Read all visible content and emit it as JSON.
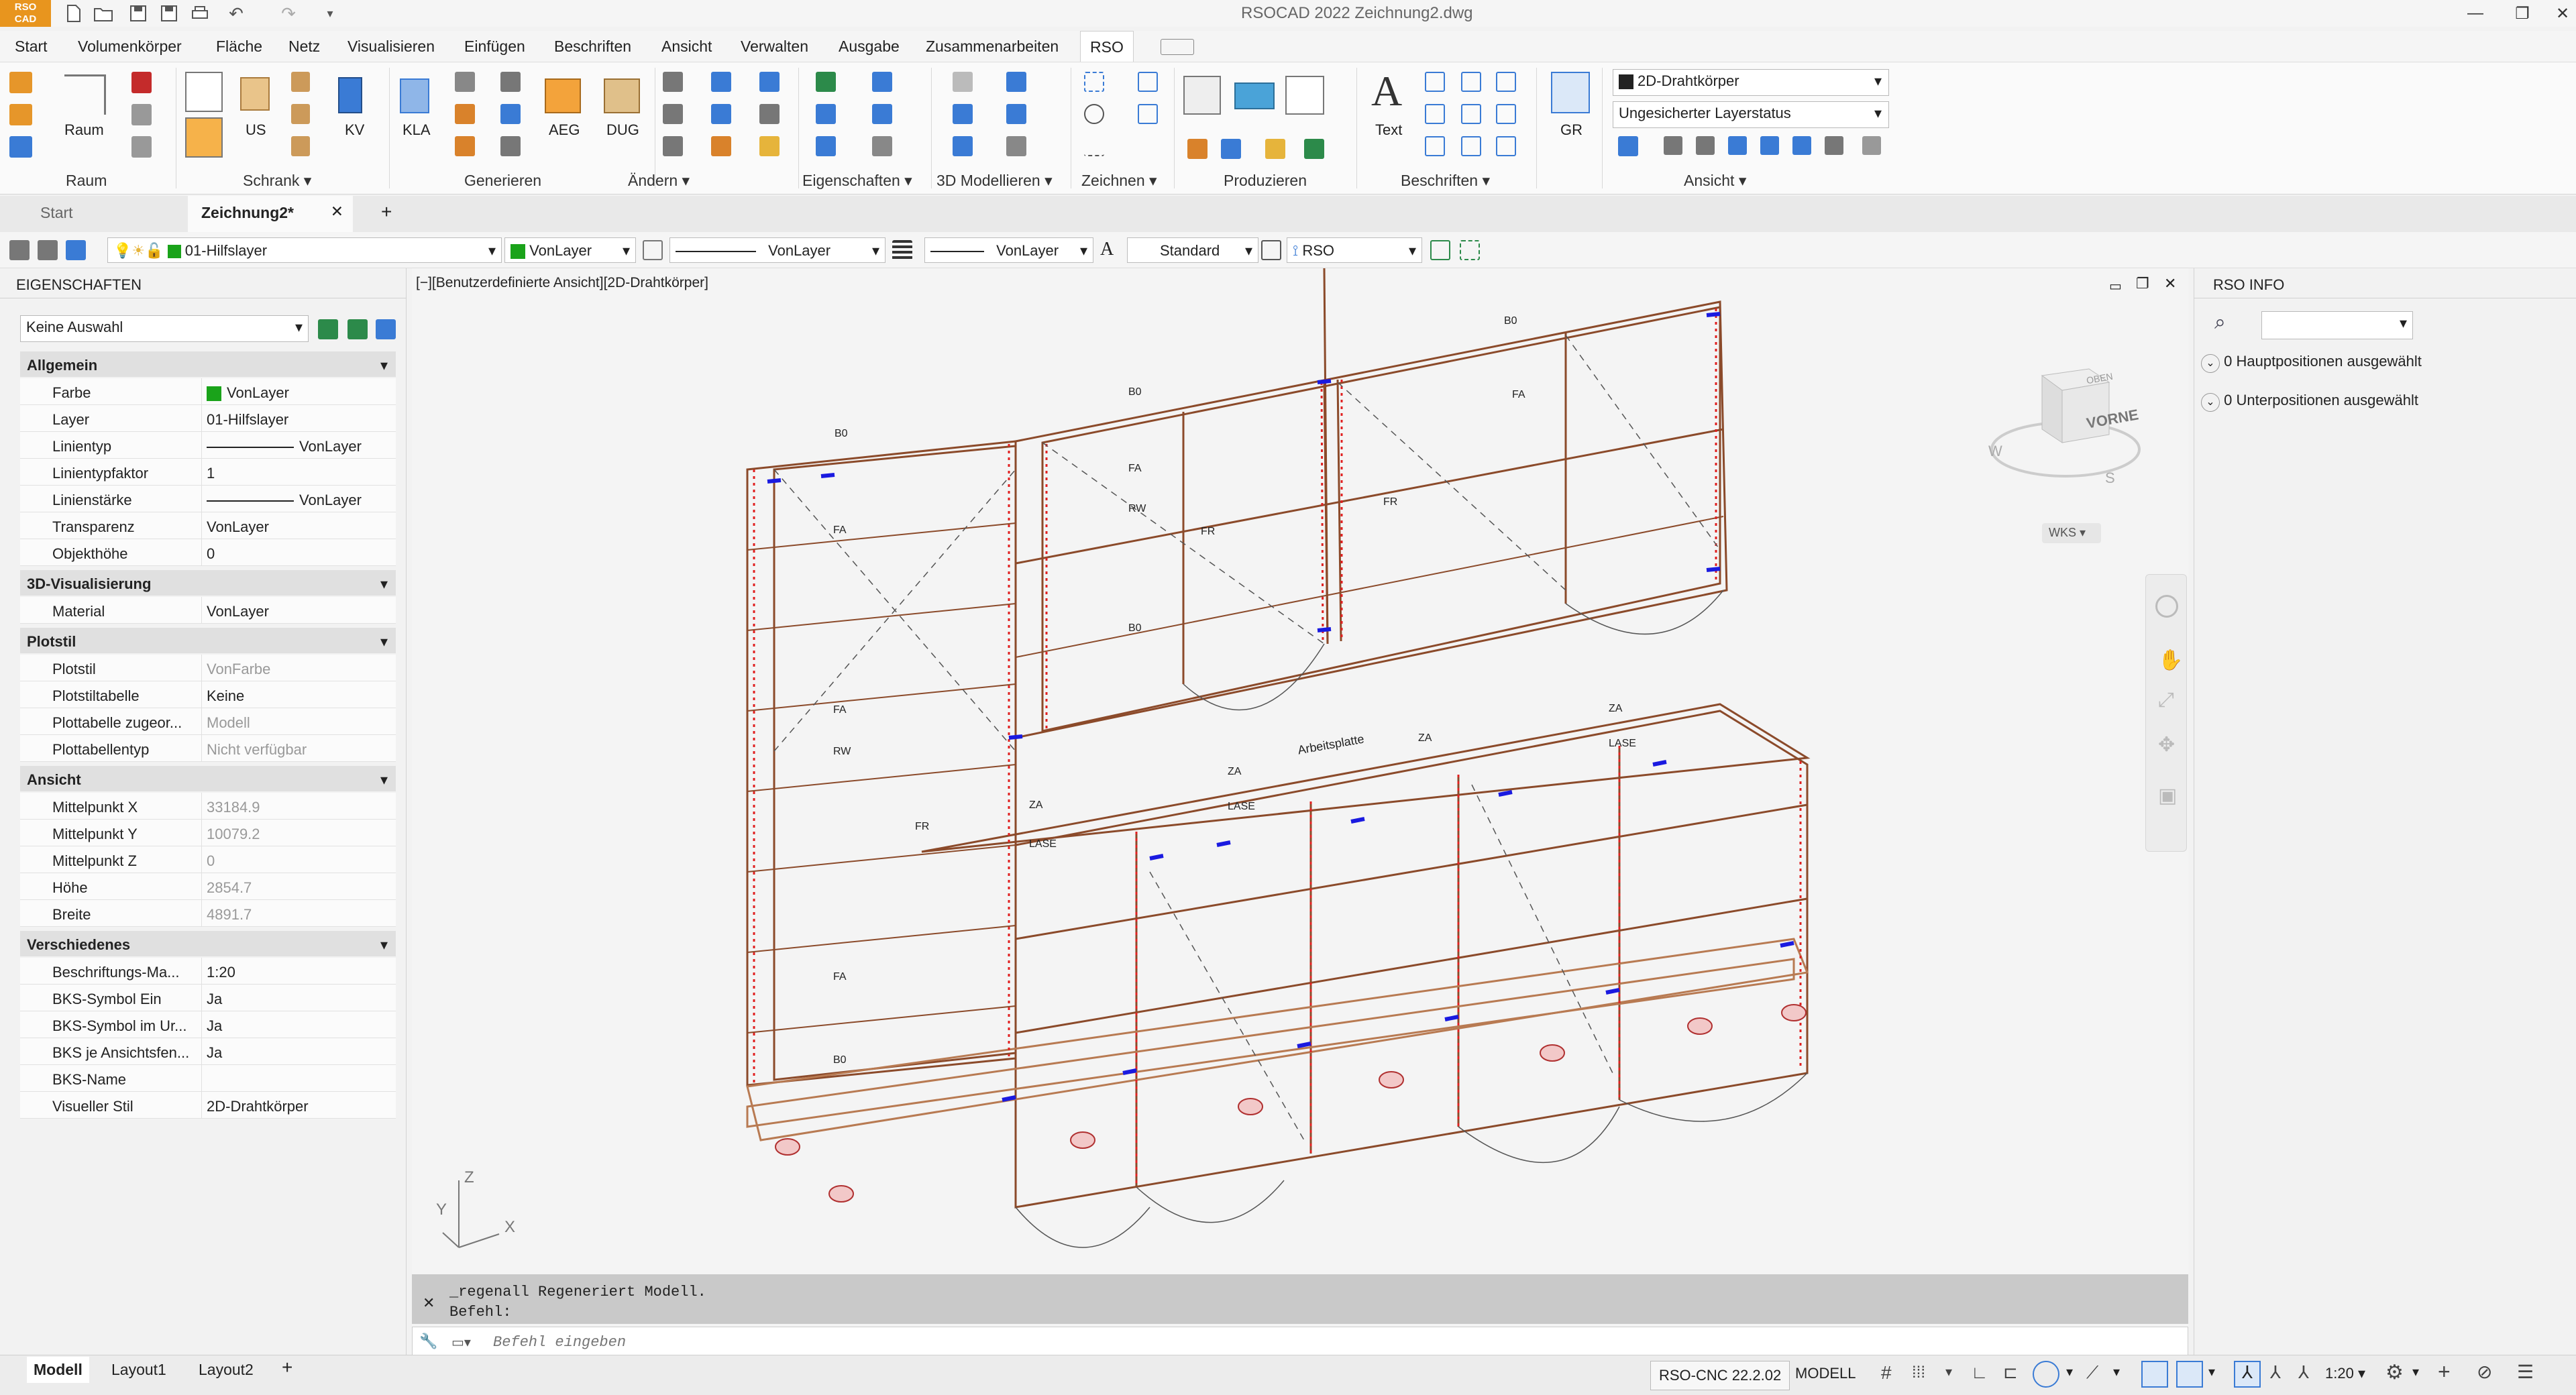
{
  "app": {
    "logo_text_top": "RSO",
    "logo_text_bottom": "CAD",
    "title": "RSOCAD 2022    Zeichnung2.dwg"
  },
  "menu": [
    "Start",
    "Volumenkörper",
    "Fläche",
    "Netz",
    "Visualisieren",
    "Einfügen",
    "Beschriften",
    "Ansicht",
    "Verwalten",
    "Ausgabe",
    "Zusammenarbeiten",
    "RSO"
  ],
  "ribbon": {
    "groups": [
      "Raum",
      "Schrank",
      "Generieren",
      "Ändern",
      "Eigenschaften",
      "3D Modellieren",
      "Zeichnen",
      "Produzieren",
      "Beschriften",
      "Ansicht"
    ],
    "buttons": [
      "Raum",
      "US",
      "KV",
      "KLA",
      "AEG",
      "DUG",
      "Text",
      "GR"
    ],
    "visual_style": "2D-Drahtkörper",
    "layer_state": "Ungesicherter Layerstatus"
  },
  "doc_tabs": [
    "Start",
    "Zeichnung2*"
  ],
  "layerbar": {
    "layer": "01-Hilfslayer",
    "color": "VonLayer",
    "linetype": "VonLayer",
    "lineweight": "VonLayer",
    "textstyle": "Standard",
    "dimstyle": "RSO"
  },
  "properties": {
    "title": "EIGENSCHAFTEN",
    "selection": "Keine Auswahl",
    "sections": [
      {
        "name": "Allgemein",
        "rows": [
          [
            "Farbe",
            "VonLayer"
          ],
          [
            "Layer",
            "01-Hilfslayer"
          ],
          [
            "Linientyp",
            "VonLayer"
          ],
          [
            "Linientypfaktor",
            "1"
          ],
          [
            "Linienstärke",
            "VonLayer"
          ],
          [
            "Transparenz",
            "VonLayer"
          ],
          [
            "Objekthöhe",
            "0"
          ]
        ]
      },
      {
        "name": "3D-Visualisierung",
        "rows": [
          [
            "Material",
            "VonLayer"
          ]
        ]
      },
      {
        "name": "Plotstil",
        "rows": [
          [
            "Plotstil",
            "VonFarbe"
          ],
          [
            "Plotstiltabelle",
            "Keine"
          ],
          [
            "Plottabelle zugeor...",
            "Modell"
          ],
          [
            "Plottabellentyp",
            "Nicht verfügbar"
          ]
        ]
      },
      {
        "name": "Ansicht",
        "rows": [
          [
            "Mittelpunkt X",
            "33184.9"
          ],
          [
            "Mittelpunkt Y",
            "10079.2"
          ],
          [
            "Mittelpunkt Z",
            "0"
          ],
          [
            "Höhe",
            "2854.7"
          ],
          [
            "Breite",
            "4891.7"
          ]
        ]
      },
      {
        "name": "Verschiedenes",
        "rows": [
          [
            "Beschriftungs-Ma...",
            "1:20"
          ],
          [
            "BKS-Symbol Ein",
            "Ja"
          ],
          [
            "BKS-Symbol im Ur...",
            "Ja"
          ],
          [
            "BKS je Ansichtsfen...",
            "Ja"
          ],
          [
            "BKS-Name",
            ""
          ],
          [
            "Visueller Stil",
            "2D-Drahtkörper"
          ]
        ]
      }
    ]
  },
  "viewport": {
    "label": "[−][Benutzerdefinierte Ansicht][2D-Drahtkörper]",
    "viewcube_face": "VORNE",
    "viewcube_top": "OBEN",
    "compass_w": "W",
    "compass_s": "S",
    "wcs": "WKS",
    "ucs_x": "X",
    "ucs_y": "Y",
    "ucs_z": "Z",
    "labels": [
      "B0",
      "B0",
      "B0",
      "B0",
      "B0",
      "FA",
      "FA",
      "FA",
      "FA",
      "FA",
      "RW",
      "RW",
      "FR",
      "FR",
      "FR",
      "ZA",
      "ZA",
      "ZA",
      "ZA",
      "LASE",
      "LASE",
      "LASE",
      "Arbeitsplatte"
    ]
  },
  "rso_info": {
    "title": "RSO INFO",
    "items": [
      "0 Hauptpositionen ausgewählt",
      "0 Unterpositionen ausgewählt"
    ]
  },
  "command": {
    "history1": "_regenall Regeneriert Modell.",
    "history2": "Befehl:",
    "placeholder": "Befehl eingeben"
  },
  "status": {
    "layout_tabs": [
      "Modell",
      "Layout1",
      "Layout2"
    ],
    "version": "RSO-CNC 22.2.02",
    "mode": "MODELL",
    "scale": "1:20"
  }
}
